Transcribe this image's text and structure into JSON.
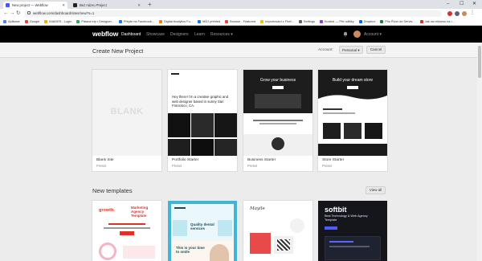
{
  "browser": {
    "tabs": [
      {
        "title": "New project — Webflow",
        "active": true
      },
      {
        "title": "Bez názvu Project",
        "active": false
      }
    ],
    "new_tab_symbol": "+",
    "window_controls": [
      "–",
      "☐",
      "✕"
    ],
    "nav": {
      "back": "←",
      "forward": "→",
      "reload": "↻"
    },
    "url": "webflow.com/dashboard/sites/new?s=1",
    "bookmarks": [
      {
        "label": "Aplikace",
        "color": "#4285f4"
      },
      {
        "label": "Google",
        "color": "#ea4335"
      },
      {
        "label": "IMAGES - Login",
        "color": "#f9ab00"
      },
      {
        "label": "Pálava trip • Designer...",
        "color": "#34a853"
      },
      {
        "label": "Přejde na Facebook...",
        "color": "#1877f2"
      },
      {
        "label": "Digital Analytics Fu...",
        "color": "#f57c00"
      },
      {
        "label": "MŮJ přehled",
        "color": "#1a73e8"
      },
      {
        "label": "Browse - Featured",
        "color": "#ea4335"
      },
      {
        "label": "Importování z Firef...",
        "color": "#fbbc04"
      },
      {
        "label": "Settings",
        "color": "#5f6368"
      },
      {
        "label": "Kontrol — Pře udělky",
        "color": "#9334e6"
      },
      {
        "label": "Dropbox",
        "color": "#0061fe"
      },
      {
        "label": "Pilo Řízeí de Servis...",
        "color": "#188038"
      },
      {
        "label": "Jak na reklamu na I...",
        "color": "#d93025"
      }
    ]
  },
  "header": {
    "logo": "webflow",
    "nav": [
      "Dashboard",
      "Showcase",
      "Designers",
      "Learn",
      "Resources ▾"
    ],
    "account_label": "Account ▾"
  },
  "heading": {
    "title": "Create New Project",
    "account_label": "Account:",
    "account_value": "Personal ▾",
    "cancel": "Cancel"
  },
  "starters": [
    {
      "name": "Blank Site",
      "sub": "Preset",
      "thumb_word": "BLANK"
    },
    {
      "name": "Portfolio Starter",
      "sub": "Preset",
      "hero": "Hey there! I'm a creative graphic and web designer based in sunny San Francisco, CA."
    },
    {
      "name": "Business Starter",
      "sub": "Preset",
      "hero": "Grow your business"
    },
    {
      "name": "Store Starter",
      "sub": "Preset",
      "hero": "Build your dream store"
    }
  ],
  "templates_section": {
    "title": "New templates",
    "view_all": "View all",
    "items": [
      {
        "logo": "growth.",
        "title": "Marketing Agency Template"
      },
      {
        "title": "Quality dental services",
        "sub": "This is your time to smile"
      },
      {
        "logo": "Mayile"
      },
      {
        "logo": "softbit",
        "tag": "Best Technology & Web Agency Template"
      }
    ]
  }
}
